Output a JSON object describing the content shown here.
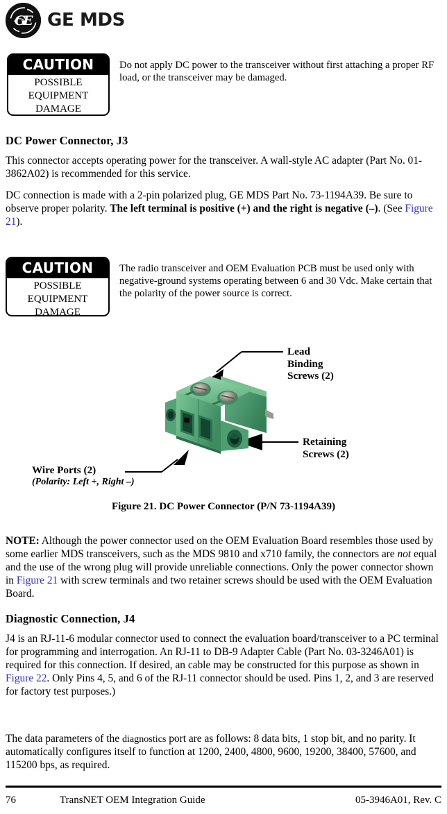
{
  "masthead": {
    "logo_mark": "ge-monogram",
    "wordmark": "GE MDS"
  },
  "caution_top": {
    "header": "CAUTION",
    "line1": "POSSIBLE",
    "line2": "EQUIPMENT",
    "line3": "DAMAGE",
    "text": "Do not apply DC power to the transceiver without first attaching a proper RF load, or the transceiver may be damaged."
  },
  "section_dc": {
    "heading": "DC Power Connector, J3",
    "para1": "This connector accepts operating power for the transceiver. A wall-style AC adapter (Part No. 01-3862A02) is recommended for this service.",
    "para2_a": "DC connection is made with a 2-pin polarized plug, GE MDS Part No. 73-1194A39. Be sure to observe proper polarity. ",
    "para2_bold": "The left terminal is positive (+) and the right is negative (–)",
    "para2_b": ". (See ",
    "para2_xref": "Figure 21",
    "para2_c": ")."
  },
  "caution_bottom": {
    "header": "CAUTION",
    "line1": "POSSIBLE",
    "line2": "EQUIPMENT",
    "line3": "DAMAGE",
    "text": "The radio transceiver and OEM Evaluation PCB must be used only with negative-ground systems operating between 6 and 30 Vdc. Make certain that the polarity of the power source is correct."
  },
  "figure": {
    "callout_lead_line1": "Lead",
    "callout_lead_line2": "Binding",
    "callout_lead_line3": "Screws (2)",
    "callout_retaining_line1": "Retaining",
    "callout_retaining_line2": "Screws (2)",
    "callout_wire_ports": "Wire Ports (2)",
    "callout_polarity": "(Polarity: Left +, Right –)",
    "caption": "Figure 21. DC Power Connector (P/N 73-1194A39)",
    "photo_alt": "green-2-pin-terminal-block-connector",
    "colors": {
      "body_green_light": "#8fd0a6",
      "body_green_mid": "#5fae7f",
      "body_green_dark": "#3d8a5e",
      "screw_metal": "#8d8d82"
    }
  },
  "note": {
    "label": "NOTE:",
    "a": "  Although the power connector used on the OEM Evaluation Board resembles those used by some earlier MDS transceivers, such as the MDS 9810 and x710 family, the connectors are ",
    "italic": "not",
    "b": " equal and the use of the wrong plug will provide unreliable connections. Only the power connector shown in ",
    "xref": "Figure 21",
    "c": " with screw terminals and two retainer screws should be used with the OEM Evaluation Board."
  },
  "section_diag": {
    "heading": "Diagnostic Connection, J4",
    "para1_a": "J4 is an RJ-11-6 modular connector used to connect the evaluation board/transceiver to a PC terminal for programming and interrogation. An RJ-11 to DB-9 Adapter Cable (Part No. 03-3246A01) is required for this connection. If desired, an cable may be constructed for this purpose as shown in ",
    "para1_xref": "Figure 22",
    "para1_b": ". Only Pins 4, 5, and 6 of the RJ-11 connector should be used. Pins 1, 2, and 3 are reserved for factory test purposes.)",
    "para2_a": "The data parameters of the ",
    "para2_small": "diagnostics",
    "para2_b": " port are as follows: 8 data bits, 1 stop bit, and no parity. It automatically configures itself to function at 1200, 2400, 4800, 9600, 19200, 38400, 57600, and 115200 bps, as required."
  },
  "footer": {
    "page_number": "76",
    "title": "TransNET OEM Integration Guide",
    "doc_number": "05-3946A01, Rev. C"
  }
}
